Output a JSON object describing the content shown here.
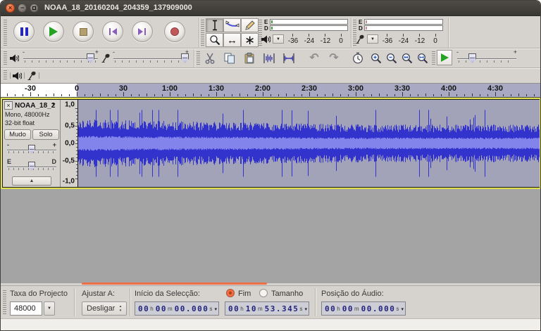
{
  "window": {
    "title": "NOAA_18_20160204_204359_137909000"
  },
  "glyphs": {
    "minus": "-",
    "plus": "+",
    "dropdown": "▼",
    "dropdown_small": "▾",
    "collapse_up": "▲",
    "close_x": "×",
    "minimize": "−",
    "undo_arrow": "↶",
    "redo_arrow": "↷",
    "left_right_arrow": "↔",
    "asterisk": "∗",
    "spin_up": "▴",
    "spin_down": "▾"
  },
  "toolbars": {
    "transport": {
      "icons": [
        "pause",
        "play",
        "stop",
        "skip-to-start",
        "skip-to-end",
        "record"
      ]
    },
    "tools": {
      "icons": [
        "selection",
        "envelope",
        "draw",
        "zoom",
        "time-shift",
        "multi-tool"
      ],
      "active": "selection"
    },
    "playback_meter": {
      "icon": "speaker",
      "channel_left": "E",
      "channel_right": "D",
      "scale": [
        "-36",
        "-24",
        "-12",
        "0"
      ]
    },
    "recording_meter": {
      "icon": "microphone",
      "channel_left": "E",
      "channel_right": "D",
      "scale": [
        "-36",
        "-24",
        "-12",
        "0"
      ]
    },
    "mixer": {
      "output_icon": "speaker",
      "input_icon": "microphone"
    },
    "edit": {
      "icons": [
        "cut",
        "copy",
        "paste",
        "trim-outside-selection",
        "silence-selection",
        "undo",
        "redo",
        "sync-clock",
        "zoom-in",
        "zoom-out",
        "fit-selection",
        "fit-project"
      ]
    },
    "transcription": {
      "icon": "play-at-speed"
    },
    "device": {
      "icons": [
        "speaker",
        "microphone"
      ]
    }
  },
  "timeline": {
    "labels": [
      "-30",
      "0",
      "30",
      "1:00",
      "1:30",
      "2:00",
      "2:30",
      "3:00",
      "3:30",
      "4:00",
      "4:30"
    ]
  },
  "track": {
    "name": "NOAA_18_2",
    "info1": "Mono, 48000Hz",
    "info2": "32-bit float",
    "mute_label": "Mudo",
    "solo_label": "Solo",
    "pan_left": "E",
    "pan_right": "D",
    "ruler_labels": [
      "1,0",
      "0,5",
      "0,0",
      "-0,5",
      "-1,0"
    ]
  },
  "waveform": {
    "seed": 18,
    "peak_start": 0.56,
    "peak_end": 0.44,
    "rms_ratio": 0.33,
    "spike_prob": 0.035,
    "color_peak": "#3232cc",
    "color_rms": "#8383ec",
    "bg_selected": "#a2a2b8"
  },
  "selection_bar": {
    "rate_label": "Taxa do Projecto",
    "rate_value": "48000",
    "snap_label": "Ajustar A:",
    "snap_value": "Desligar",
    "sel_start_label": "Início da Selecção:",
    "end_label": "Fim",
    "length_label": "Tamanho",
    "audio_pos_label": "Posição do Áudio:",
    "sel_start_parts": [
      "00",
      "h",
      "00",
      "m",
      "00.000",
      "s"
    ],
    "sel_end_parts": [
      "00",
      "h",
      "10",
      "m",
      "53.345",
      "s"
    ],
    "audio_pos_parts": [
      "00",
      "h",
      "00",
      "m",
      "00.000",
      "s"
    ]
  },
  "colors": {
    "accent_orange": "#ee6f45",
    "wave_blue": "#3232cc",
    "selection_shade": "#a9a9c3",
    "titlebar_bg": "#3c3a35"
  }
}
